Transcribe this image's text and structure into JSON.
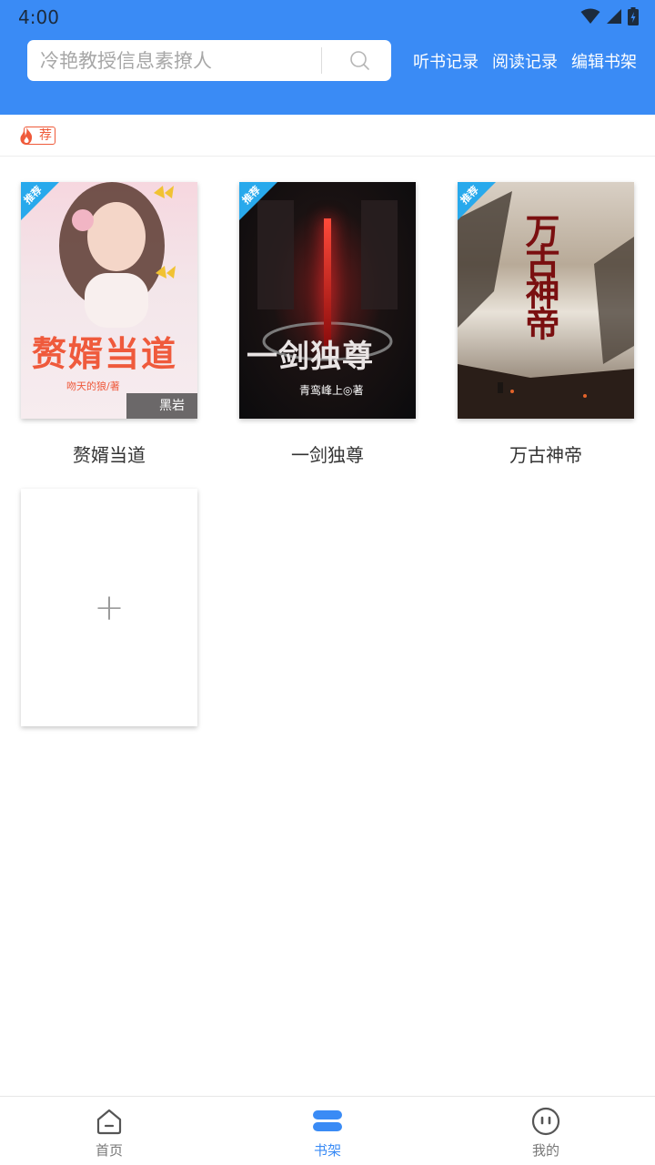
{
  "status_bar": {
    "time": "4:00"
  },
  "search": {
    "placeholder": "冷艳教授信息素撩人"
  },
  "header_links": [
    "听书记录",
    "阅读记录",
    "编辑书架"
  ],
  "recommend_tag": "荐",
  "ribbon_label": "推荐",
  "books": [
    {
      "title": "赘婿当道",
      "cover_title": "赘婿当道",
      "cover_author": "吻天的狼/著",
      "cover_brand": "黑岩"
    },
    {
      "title": "一剑独尊",
      "cover_title": "一剑独尊",
      "cover_author": "青鸾峰上◎著"
    },
    {
      "title": "万古神帝",
      "cover_title": "万古神帝"
    }
  ],
  "add_card": {
    "label": "+"
  },
  "bottom_nav": [
    {
      "label": "首页",
      "icon": "home-icon",
      "active": false
    },
    {
      "label": "书架",
      "icon": "bookshelf-icon",
      "active": true
    },
    {
      "label": "我的",
      "icon": "profile-icon",
      "active": false
    }
  ],
  "colors": {
    "primary": "#3a8bf5",
    "recommend": "#ef5a3a",
    "ribbon": "#28a9ec"
  }
}
